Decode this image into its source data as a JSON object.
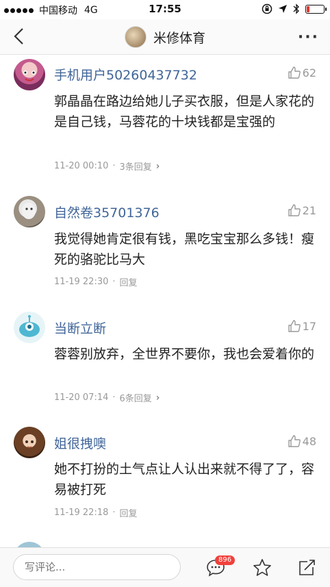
{
  "status_bar": {
    "carrier": "中国移动",
    "network": "4G",
    "time": "17:55"
  },
  "nav": {
    "title": "米修体育",
    "more_label": "···"
  },
  "comments": [
    {
      "username": "手机用户50260437732",
      "likes": "62",
      "text": "郭晶晶在路边给她儿子买衣服，但是人家花的是自己钱，马蓉花的十块钱都是宝强的",
      "time": "11-20 00:10",
      "reply": "3条回复",
      "has_chevron": true
    },
    {
      "username": "自然卷35701376",
      "likes": "21",
      "text": "我觉得她肯定很有钱，黑吃宝宝那么多钱！瘦死的骆驼比马大",
      "time": "11-19 22:30",
      "reply": "回复",
      "has_chevron": false
    },
    {
      "username": "当断立断",
      "likes": "17",
      "text": "蓉蓉别放弃，全世界不要你，我也会爱着你的",
      "time": "11-20 07:14",
      "reply": "6条回复",
      "has_chevron": true
    },
    {
      "username": "姐很拽噢",
      "likes": "48",
      "text": "她不打扮的土气点让人认出来就不得了了，容易被打死",
      "time": "11-19 22:18",
      "reply": "回复",
      "has_chevron": false
    }
  ],
  "bottom_bar": {
    "input_placeholder": "写评论...",
    "comment_count_badge": "896"
  },
  "colors": {
    "username": "#406599",
    "meta": "#999999",
    "badge": "#f0413b"
  }
}
